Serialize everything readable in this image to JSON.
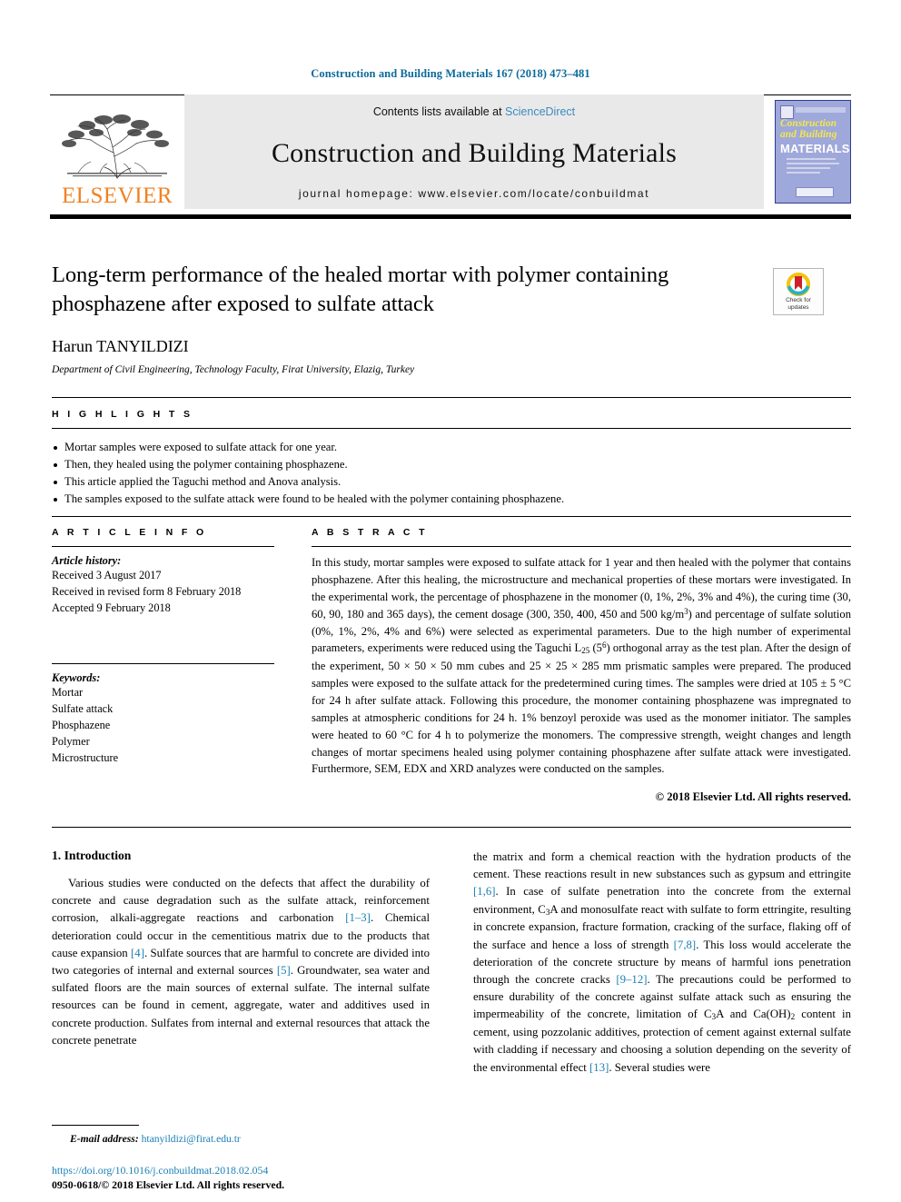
{
  "running_head": "Construction and Building Materials 167 (2018) 473–481",
  "masthead": {
    "publisher": "ELSEVIER",
    "contents_prefix": "Contents lists available at ",
    "contents_link": "ScienceDirect",
    "journal_title": "Construction and Building Materials",
    "homepage": "journal homepage: www.elsevier.com/locate/conbuildmat",
    "cover": {
      "line1": "Construction",
      "line2": "and Building",
      "line3": "MATERIALS"
    }
  },
  "article": {
    "title": "Long-term performance of the healed mortar with polymer containing phosphazene after exposed to sulfate attack",
    "author": "Harun TANYILDIZI",
    "affiliation": "Department of Civil Engineering, Technology Faculty, Firat University, Elazig, Turkey",
    "crossmark_line1": "Check for",
    "crossmark_line2": "updates"
  },
  "highlights": {
    "label": "H I G H L I G H T S",
    "items": [
      "Mortar samples were exposed to sulfate attack for one year.",
      "Then, they healed using the polymer containing phosphazene.",
      "This article applied the Taguchi method and Anova analysis.",
      "The samples exposed to the sulfate attack were found to be healed with the polymer containing phosphazene."
    ]
  },
  "article_info": {
    "label": "A R T I C L E     I N F O",
    "history_heading": "Article history:",
    "history": [
      "Received 3 August 2017",
      "Received in revised form 8 February 2018",
      "Accepted 9 February 2018"
    ],
    "keywords_heading": "Keywords:",
    "keywords": [
      "Mortar",
      "Sulfate attack",
      "Phosphazene",
      "Polymer",
      "Microstructure"
    ]
  },
  "abstract": {
    "label": "A B S T R A C T",
    "rights": "© 2018 Elsevier Ltd. All rights reserved."
  },
  "introduction": {
    "heading": "1. Introduction"
  },
  "footnote": {
    "label": "E-mail address:",
    "email": "htanyildizi@firat.edu.tr"
  },
  "footer": {
    "doi": "https://doi.org/10.1016/j.conbuildmat.2018.02.054",
    "copyright": "0950-0618/© 2018 Elsevier Ltd. All rights reserved."
  },
  "colors": {
    "running_head": "#0b6a9b",
    "elsevier_orange": "#F08121",
    "link_blue": "#1a7fb5",
    "sciencedirect_blue": "#3a8bbf",
    "cover_bg": "#9fa8da",
    "cover_yellow": "#f2e74b"
  }
}
